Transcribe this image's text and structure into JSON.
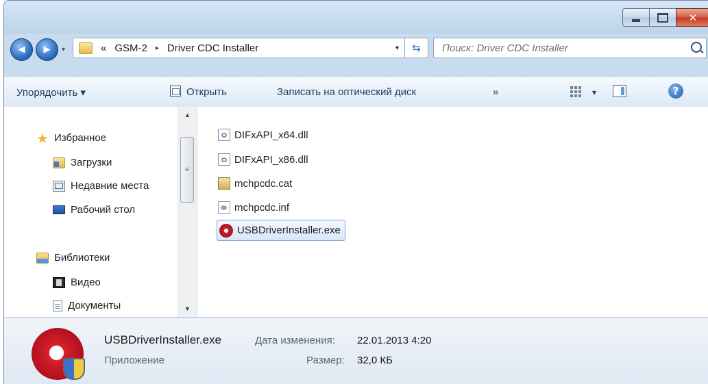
{
  "window": {
    "caption_buttons": {
      "minimize": "–",
      "maximize": "□",
      "close": "✕"
    }
  },
  "address": {
    "overflow": "«",
    "crumbs": [
      "GSM-2",
      "Driver CDC Installer"
    ],
    "separator": "▸",
    "dropdown": "▾",
    "back": "◀",
    "forward": "▶",
    "search_placeholder": "Поиск: Driver CDC Installer"
  },
  "toolbar": {
    "organize": "Упорядочить ▾",
    "open": "Открыть",
    "burn": "Записать на оптический диск",
    "more": "»",
    "views_dropdown": "▾"
  },
  "navigation": {
    "favorites": "Избранное",
    "favorites_items": [
      "Загрузки",
      "Недавние места",
      "Рабочий стол"
    ],
    "libraries": "Библиотеки",
    "libraries_items": [
      "Видео",
      "Документы"
    ]
  },
  "files": [
    {
      "name": "DIFxAPI_x64.dll",
      "icon": "dll-file-icon"
    },
    {
      "name": "DIFxAPI_x86.dll",
      "icon": "dll-file-icon"
    },
    {
      "name": "mchpcdc.cat",
      "icon": "security-catalog-icon"
    },
    {
      "name": "mchpcdc.inf",
      "icon": "setup-info-icon"
    },
    {
      "name": "USBDriverInstaller.exe",
      "icon": "microchip-app-icon",
      "selected": true
    }
  ],
  "details": {
    "name": "USBDriverInstaller.exe",
    "type": "Приложение",
    "modified_label": "Дата изменения:",
    "modified_value": "22.01.2013 4:20",
    "size_label": "Размер:",
    "size_value": "32,0 КБ"
  }
}
